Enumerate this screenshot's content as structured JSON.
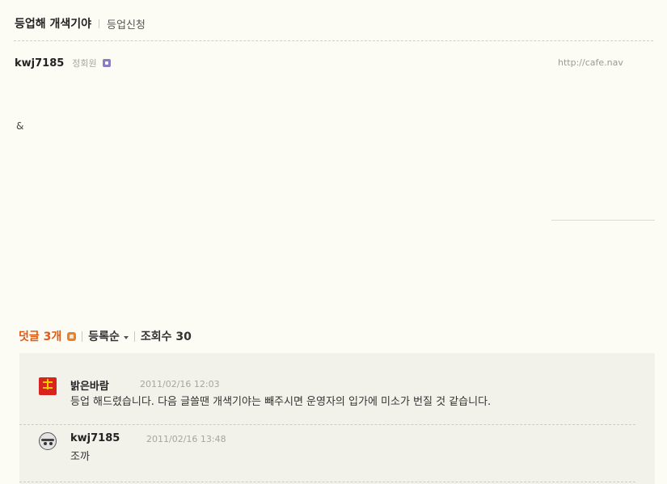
{
  "post": {
    "title": "등업해 개색기야",
    "category": "등업신청",
    "author": "kwj7185",
    "author_grade": "정회원",
    "url_fragment": "http://cafe.nav",
    "body": "&"
  },
  "comments_bar": {
    "label": "덧글 3개",
    "sort_label": "등록순",
    "views_label": "조회수 30"
  },
  "comments": [
    {
      "nickname": "밝은바람",
      "date": "2011/02/16 12:03",
      "text": "등업 해드렸습니다. 다음 글쓸땐 개색기야는 빼주시면 운영자의 입가에 미소가 번질 것 같습니다."
    },
    {
      "nickname": "kwj7185",
      "date": "2011/02/16 13:48",
      "text": "조까"
    }
  ],
  "colors": {
    "background": "#fcfcf5",
    "comment_area": "#f2f2ea",
    "comment_count": "#e05a12"
  }
}
